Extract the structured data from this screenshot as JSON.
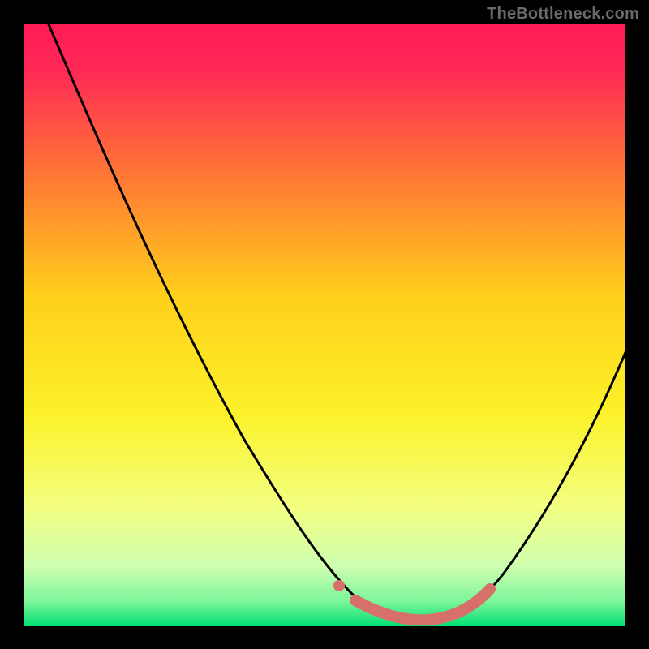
{
  "watermark": "TheBottleneck.com",
  "chart_data": {
    "type": "line",
    "title": "",
    "xlabel": "",
    "ylabel": "",
    "xlim": [
      0,
      100
    ],
    "ylim": [
      0,
      100
    ],
    "grid": false,
    "series": [
      {
        "name": "bottleneck-curve",
        "x": [
          0,
          5,
          10,
          15,
          20,
          25,
          30,
          35,
          40,
          45,
          50,
          53,
          56,
          60,
          64,
          68,
          72,
          76,
          80,
          84,
          88,
          92,
          96,
          100
        ],
        "y": [
          100,
          93,
          86,
          78,
          70,
          62,
          53,
          45,
          36,
          27,
          18,
          12,
          7,
          3,
          1,
          0,
          0,
          1,
          4,
          10,
          18,
          28,
          40,
          54
        ]
      },
      {
        "name": "optimum-band",
        "x": [
          53,
          60,
          66,
          72
        ],
        "y": [
          3,
          1,
          0,
          1
        ]
      }
    ],
    "annotations": []
  },
  "colors": {
    "background_top": "#ff1a4d",
    "background_mid1": "#ff7a33",
    "background_mid2": "#ffd91a",
    "background_mid3": "#f7ff66",
    "background_mid4": "#ccffb3",
    "background_bottom": "#00e070",
    "curve": "#000000",
    "highlight": "#d9716a"
  }
}
